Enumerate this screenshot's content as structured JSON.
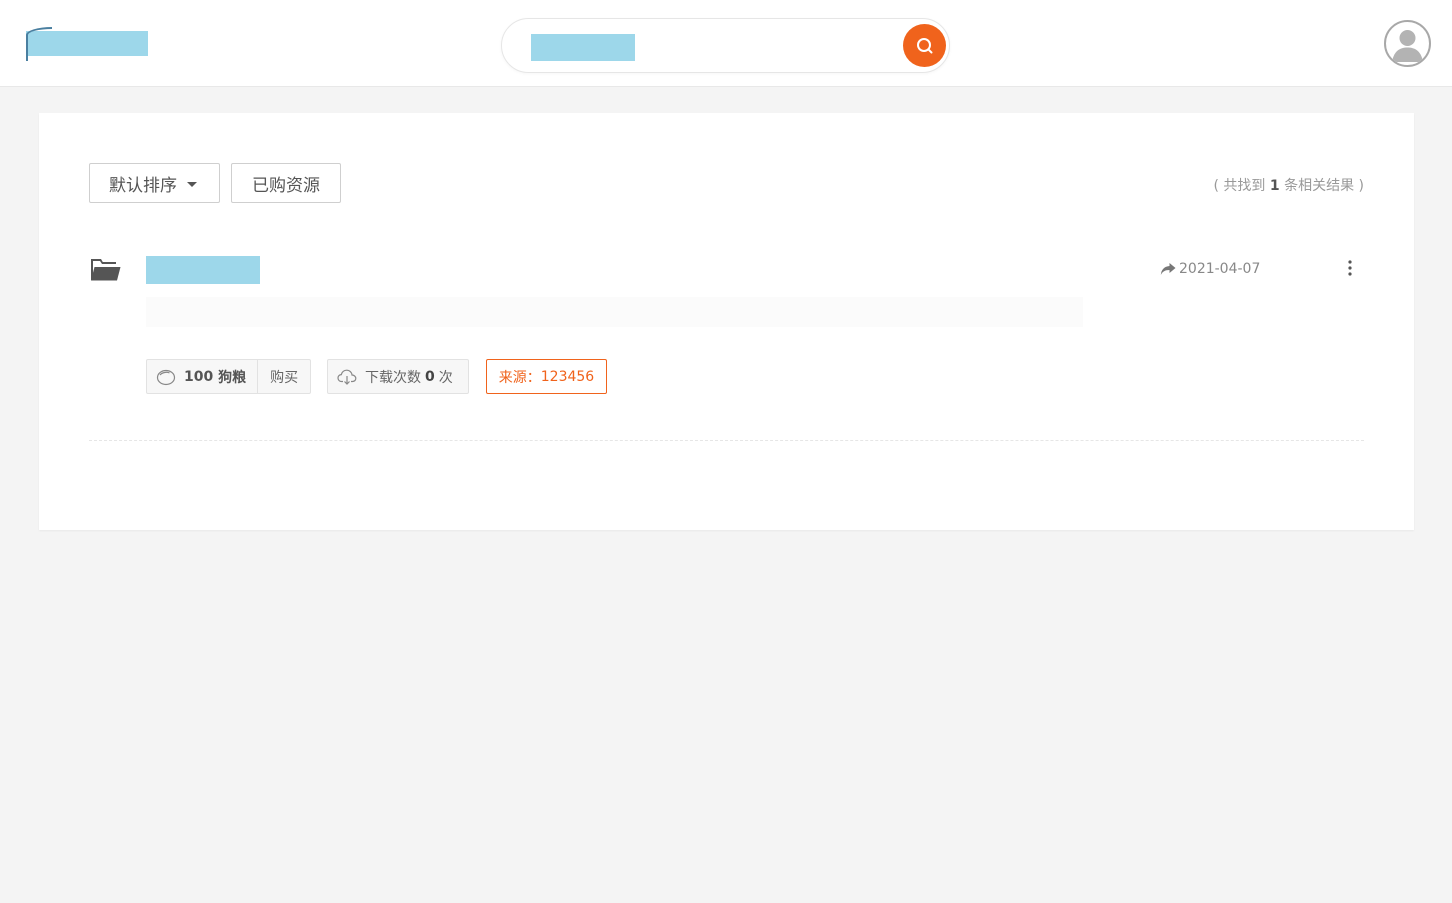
{
  "header": {
    "search": {
      "placeholder": "",
      "value": ""
    },
    "icons": {
      "search": "search-icon",
      "avatar": "user-avatar-icon"
    }
  },
  "toolbar": {
    "sort_label": "默认排序",
    "purchased_label": "已购资源",
    "result_prefix": "( 共找到",
    "result_count": "1",
    "result_suffix": "条相关结果 )"
  },
  "results": [
    {
      "icon": "folder-open-icon",
      "date": "2021-04-07",
      "price_value": "100",
      "price_unit": "狗粮",
      "buy_label": "购买",
      "download_prefix": "下载次数",
      "download_count": "0",
      "download_suffix": "次",
      "source_label": "来源：",
      "source_value": "123456"
    }
  ],
  "colors": {
    "accent": "#f0631c",
    "placeholder_block": "#9dd7ea",
    "background": "#f4f4f4"
  }
}
